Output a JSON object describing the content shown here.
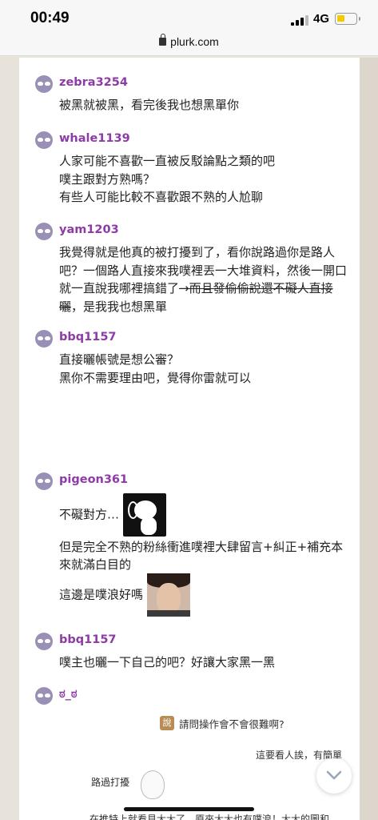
{
  "status_bar": {
    "time": "00:49",
    "network": "4G",
    "battery_color": "#f5c900"
  },
  "browser": {
    "url": "plurk.com"
  },
  "colors": {
    "username": "#8e3aa7",
    "avatar": "#9a8fb5",
    "background": "#e7e2da"
  },
  "responses": [
    {
      "user": "zebra3254",
      "lines": [
        "被黑就被黑，看完後我也想黑單你"
      ]
    },
    {
      "user": "whale1139",
      "lines": [
        "人家可能不喜歡一直被反駁論點之類的吧",
        "噗主跟對方熟嗎？",
        "有些人可能比較不喜歡跟不熟的人尬聊"
      ]
    },
    {
      "user": "yam1203",
      "text_plain": "我覺得就是他真的被打擾到了，看你說路過你是路人吧？一個路人直接來我噗裡丟一大堆資料，然後一開口就一直說我哪裡搞錯了",
      "text_strike": "→而且發偷偷說還不礙人直接曬",
      "text_tail": "，是我我也想黑單"
    },
    {
      "user": "bbq1157",
      "lines": [
        "直接曬帳號是想公審？",
        "黑你不需要理由吧，覺得你雷就可以"
      ]
    },
    {
      "user": "pigeon361",
      "line1": "不礙對方…",
      "line2": "但是完全不熟的粉絲衝進噗裡大肆留言+糾正+補充本來就滿白目的",
      "line3": "這邊是噗浪好嗎",
      "stickers": [
        "snoopy-sticker",
        "face-sticker"
      ]
    },
    {
      "user": "bbq1157",
      "lines": [
        "噗主也曬一下自己的吧？好讓大家黑一黑"
      ]
    },
    {
      "user": "ಠ_ಠ"
    }
  ],
  "embedded_screenshot": {
    "badge": "說",
    "question": "請問操作會不會很難啊?",
    "reply": "這要看人誒，有簡單",
    "fragment": "路過打擾",
    "bottom_line": "在推特上就看見大大了，原來大大也有噗浪！大大的圖和"
  }
}
